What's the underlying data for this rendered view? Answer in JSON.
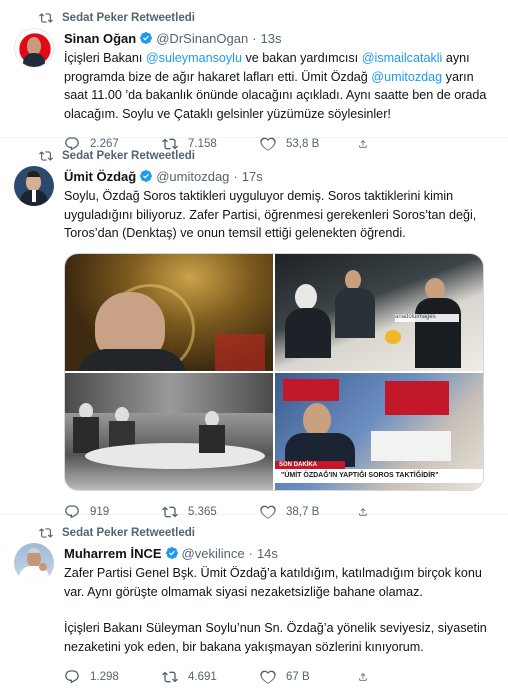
{
  "tweets": [
    {
      "retweet_label": "Sedat Peker Retweetledi",
      "name": "Sinan Oğan",
      "handle": "@DrSinanOgan",
      "separator": "·",
      "time": "13s",
      "text_parts": [
        {
          "t": "İçişleri Bakanı "
        },
        {
          "t": "@suleymansoylu",
          "m": true
        },
        {
          "t": " ve bakan yardımcısı "
        },
        {
          "t": "@ismailcatakli",
          "m": true
        },
        {
          "t": " aynı programda bize de ağır hakaret lafları etti. Ümit Özdağ "
        },
        {
          "t": "@umitozdag",
          "m": true
        },
        {
          "t": " yarın saat 11.00 ’da bakanlık önünde olacağını açıkladı. Aynı saatte ben de orada olacağım. Soylu ve Çataklı gelsinler yüzümüze söylesinler!"
        }
      ],
      "replies": "2.267",
      "retweets": "7.158",
      "likes": "53,8 B"
    },
    {
      "retweet_label": "Sedat Peker Retweetledi",
      "name": "Ümit Özdağ",
      "handle": "@umitozdag",
      "separator": "·",
      "time": "17s",
      "text": "Soylu, Özdağ Soros taktikleri uyguluyor demiş. Soros taktiklerini kimin uyguladığını biliyoruz. Zafer Partisi, öğrenmesi gerekenleri Soros’tan deği, Toros’dan (Denktaş) ve onun temsil ettiği gelenekten öğrendi.",
      "media_caption_1": "SON DAKİKA",
      "media_caption_2": "\"ÜMİT ÖZDAĞ'IN YAPTIĞI SOROS TAKTİĞİDİR\"",
      "media_watermark": "anadoluimages",
      "replies": "919",
      "retweets": "5.365",
      "likes": "38,7 B"
    },
    {
      "retweet_label": "Sedat Peker Retweetledi",
      "name": "Muharrem İNCE",
      "handle": "@vekilince",
      "separator": "·",
      "time": "14s",
      "paragraph_1": "Zafer Partisi Genel Bşk. Ümit Özdağ’a katıldığım, katılmadığım birçok konu var. Aynı görüşte olmamak siyasi nezaketsizliğe bahane olamaz.",
      "paragraph_2": "İçişleri Bakanı Süleyman Soylu’nun Sn. Özdağ’a yönelik seviyesiz, siyasetin nezaketini yok eden, bir bakana yakışmayan sözlerini kınıyorum.",
      "replies": "1.298",
      "retweets": "4.691",
      "likes": "67 B"
    }
  ],
  "colors": {
    "accent": "#1d9bf0",
    "muted": "#536471",
    "text": "#0f1419",
    "divider": "#eff3f4"
  },
  "icons": [
    "retweet-icon",
    "verified-badge-icon",
    "reply-icon",
    "like-icon",
    "share-icon"
  ]
}
